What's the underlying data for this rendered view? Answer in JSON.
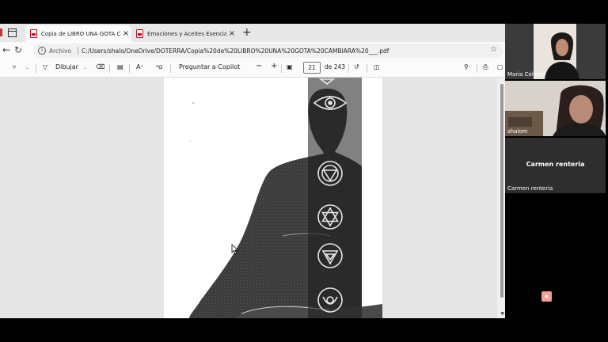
{
  "browser": {
    "tabs": [
      {
        "label": "Copia de LIBRO UNA GOTA CAMBIARÁ",
        "active": true,
        "close": "×"
      },
      {
        "label": "Emociones y Aceites Esenciales (E",
        "active": false,
        "close": "×"
      }
    ],
    "new_tab": "+",
    "address": {
      "security_label": "Archivo",
      "url": "C:/Users/shalo/OneDrive/DOTERRA/Copia%20de%20LIBRO%20UNA%20GOTA%20CAMBIARA%20___.pdf"
    }
  },
  "pdf_toolbar": {
    "draw_label": "Dibujar",
    "copilot_label": "Preguntar a Copilot",
    "zoom_out": "−",
    "zoom_in": "+",
    "page_current": "21",
    "page_total": "de 243"
  },
  "video_call": {
    "participants": [
      {
        "name": "Maria Celeste"
      },
      {
        "name": "shalom"
      },
      {
        "name": "Carmen renteria",
        "center_label": "Carmen renteria"
      }
    ]
  },
  "icons": [
    "pdf-icon",
    "refresh-icon",
    "back-icon",
    "info-icon",
    "star-icon",
    "highlighter-icon",
    "draw-icon",
    "eraser-icon",
    "text-icon",
    "read-aloud-icon",
    "translate-icon",
    "fit-page-icon",
    "rotate-icon",
    "two-page-icon",
    "search-icon",
    "print-icon",
    "save-icon",
    "acrobat-icon",
    "cursor-icon"
  ],
  "colors": {
    "pdf_red": "#d0021b",
    "tab_bar": "#e7e7e7",
    "viewer_bg": "#e5e5e5"
  }
}
